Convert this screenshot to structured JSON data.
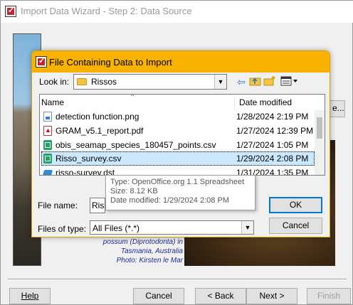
{
  "wizard": {
    "title": "Import Data Wizard - Step 2: Data Source",
    "side_button_label": "e...",
    "photo_caption_lines": [
      "possum (Diprotodonta) in",
      "Tasmania, Australia",
      "Photo: Kirsten le Mar"
    ],
    "buttons": {
      "help": "Help",
      "cancel": "Cancel",
      "back": "< Back",
      "next": "Next >",
      "finish": "Finish"
    }
  },
  "dialog": {
    "title": "File Containing Data to Import",
    "lookin_label": "Look in:",
    "lookin_value": "Rissos",
    "columns": {
      "name": "Name",
      "date": "Date modified"
    },
    "files": [
      {
        "name": "detection function.png",
        "date": "1/28/2024 2:19 PM",
        "icon": "png-file-icon"
      },
      {
        "name": "GRAM_v5.1_report.pdf",
        "date": "1/27/2024 12:39 PM",
        "icon": "pdf-file-icon"
      },
      {
        "name": "obis_seamap_species_180457_points.csv",
        "date": "1/27/2024 1:05 PM",
        "icon": "csv-file-icon"
      },
      {
        "name": "Risso_survey.csv",
        "date": "1/29/2024 2:08 PM",
        "icon": "csv-file-icon",
        "selected": true
      },
      {
        "name": "risso-survey.dst",
        "date": "1/31/2024 1:35 PM",
        "icon": "dst-file-icon"
      }
    ],
    "tooltip": {
      "type": "Type: OpenOffice.org 1.1 Spreadsheet",
      "size": "Size: 8.12 KB",
      "modified": "Date modified: 1/29/2024 2:08 PM"
    },
    "filename_label": "File name:",
    "filename_value": "Risso",
    "filetype_label": "Files of type:",
    "filetype_value": "All Files (*.*)",
    "ok_label": "OK",
    "cancel_label": "Cancel"
  },
  "colors": {
    "dialog_titlebar": "#f9b200",
    "selection": "#cce8ff",
    "caption_text": "#1c2f8f"
  }
}
